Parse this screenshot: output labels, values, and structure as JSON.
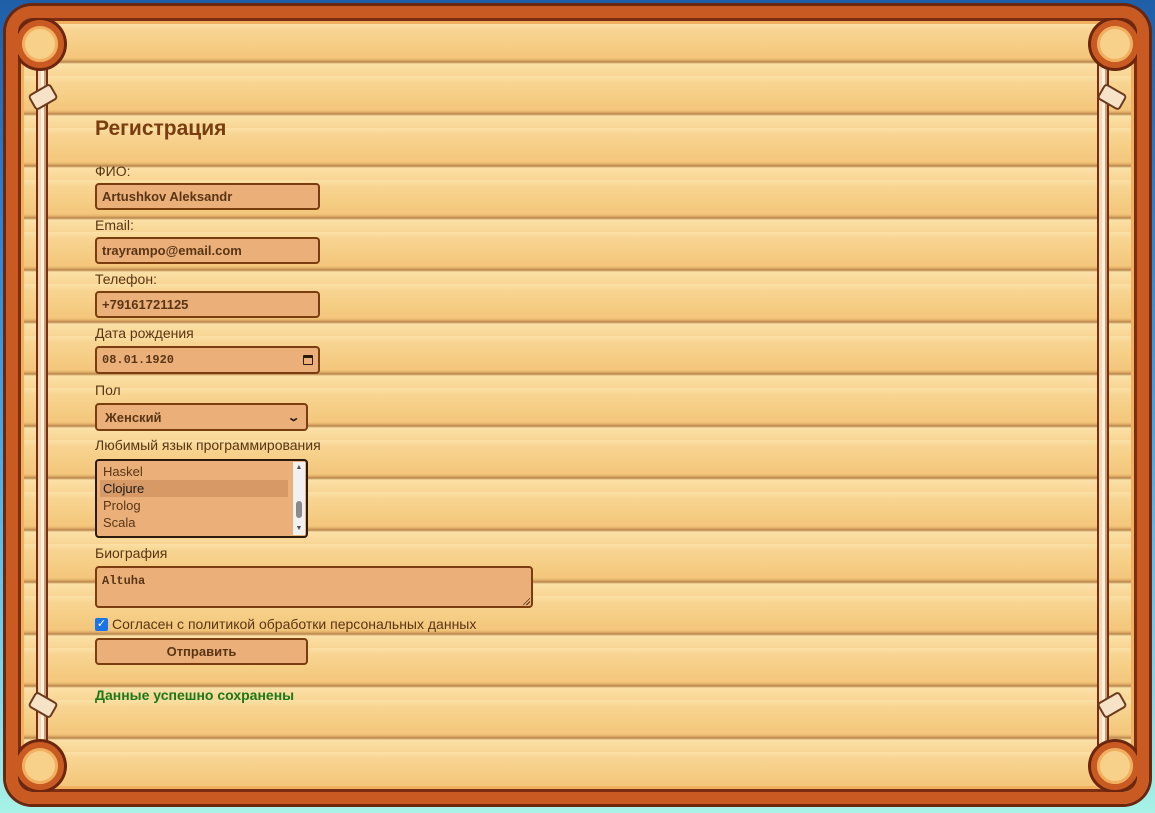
{
  "form": {
    "title": "Регистрация",
    "fio": {
      "label": "ФИО:",
      "value": "Artushkov Aleksandr"
    },
    "email": {
      "label": "Email:",
      "value": "trayrampo@email.com"
    },
    "phone": {
      "label": "Телефон:",
      "value": "+79161721125"
    },
    "birthdate": {
      "label": "Дата рождения",
      "value": "08.01.1920"
    },
    "gender": {
      "label": "Пол",
      "value": "Женский"
    },
    "language": {
      "label": "Любимый язык программирования",
      "options": [
        "Haskel",
        "Clojure",
        "Prolog",
        "Scala"
      ],
      "selected": "Clojure"
    },
    "bio": {
      "label": "Биография",
      "value": "Altuha"
    },
    "agree": {
      "label": "Согласен с политикой обработки персональных данных",
      "checked": true
    },
    "submit_label": "Отправить",
    "success_message": "Данные успешно сохранены"
  },
  "icons": {
    "calendar": "calendar-icon",
    "dropdown": "chevron-down-icon",
    "checkbox": "checkmark-icon"
  },
  "colors": {
    "heading": "#7a3d10",
    "field_bg": "#ebb07a",
    "field_border": "#7a3d10",
    "success": "#1a7a1a",
    "checkbox_accent": "#1a73e8"
  }
}
